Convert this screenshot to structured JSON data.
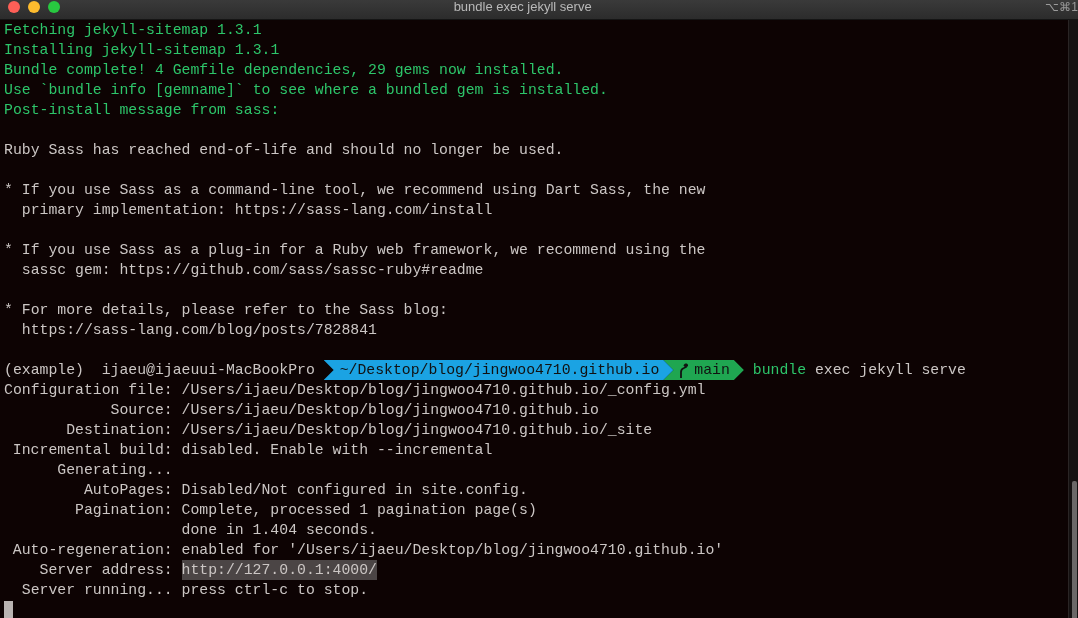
{
  "window": {
    "title": "bundle exec jekyll serve",
    "shortcut": "⌥⌘1"
  },
  "lines": [
    {
      "kind": "output",
      "text": "Fetching jekyll-sitemap 1.3.1"
    },
    {
      "kind": "output",
      "text": "Installing jekyll-sitemap 1.3.1"
    },
    {
      "kind": "output",
      "text": "Bundle complete! 4 Gemfile dependencies, 29 gems now installed."
    },
    {
      "kind": "output",
      "text": "Use `bundle info [gemname]` to see where a bundled gem is installed."
    },
    {
      "kind": "output",
      "text": "Post-install message from sass:"
    },
    {
      "kind": "blank"
    },
    {
      "kind": "text",
      "text": "Ruby Sass has reached end-of-life and should no longer be used."
    },
    {
      "kind": "blank"
    },
    {
      "kind": "text",
      "text": "* If you use Sass as a command-line tool, we recommend using Dart Sass, the new"
    },
    {
      "kind": "text",
      "text": "  primary implementation: https://sass-lang.com/install"
    },
    {
      "kind": "blank"
    },
    {
      "kind": "text",
      "text": "* If you use Sass as a plug-in for a Ruby web framework, we recommend using the"
    },
    {
      "kind": "text",
      "text": "  sassc gem: https://github.com/sass/sassc-ruby#readme"
    },
    {
      "kind": "blank"
    },
    {
      "kind": "text",
      "text": "* For more details, please refer to the Sass blog:"
    },
    {
      "kind": "text",
      "text": "  https://sass-lang.com/blog/posts/7828841"
    },
    {
      "kind": "blank"
    },
    {
      "kind": "prompt",
      "env": "(example)",
      "user": "ijaeu@ijaeuui-MacBookPro",
      "segments": [
        {
          "kind": "path",
          "text": "~/Desktop/blog/jingwoo4710.github.io",
          "color": "#1ba3e3"
        },
        {
          "kind": "branch",
          "text": "main",
          "color": "#1fa651"
        }
      ],
      "program": "bundle",
      "args": "exec jekyll serve"
    },
    {
      "kind": "field",
      "label": "Configuration file:",
      "value": "/Users/ijaeu/Desktop/blog/jingwoo4710.github.io/_config.yml"
    },
    {
      "kind": "field",
      "label": "Source:",
      "value": "/Users/ijaeu/Desktop/blog/jingwoo4710.github.io"
    },
    {
      "kind": "field",
      "label": "Destination:",
      "value": "/Users/ijaeu/Desktop/blog/jingwoo4710.github.io/_site"
    },
    {
      "kind": "field",
      "label": "Incremental build:",
      "value": "disabled. Enable with --incremental"
    },
    {
      "kind": "field",
      "label": "Generating..."
    },
    {
      "kind": "field",
      "label": "AutoPages:",
      "value": "Disabled/Not configured in site.config."
    },
    {
      "kind": "field",
      "label": "Pagination:",
      "value": "Complete, processed 1 pagination page(s)"
    },
    {
      "kind": "field",
      "value": "done in 1.404 seconds."
    },
    {
      "kind": "field",
      "label": "Auto-regeneration:",
      "value": "enabled for '/Users/ijaeu/Desktop/blog/jingwoo4710.github.io'"
    },
    {
      "kind": "field",
      "label": "Server address:",
      "value": "http://127.0.0.1:4000/",
      "selected": true
    },
    {
      "kind": "field",
      "label": "Server running...",
      "value": "press ctrl-c to stop."
    },
    {
      "kind": "cursor"
    }
  ]
}
